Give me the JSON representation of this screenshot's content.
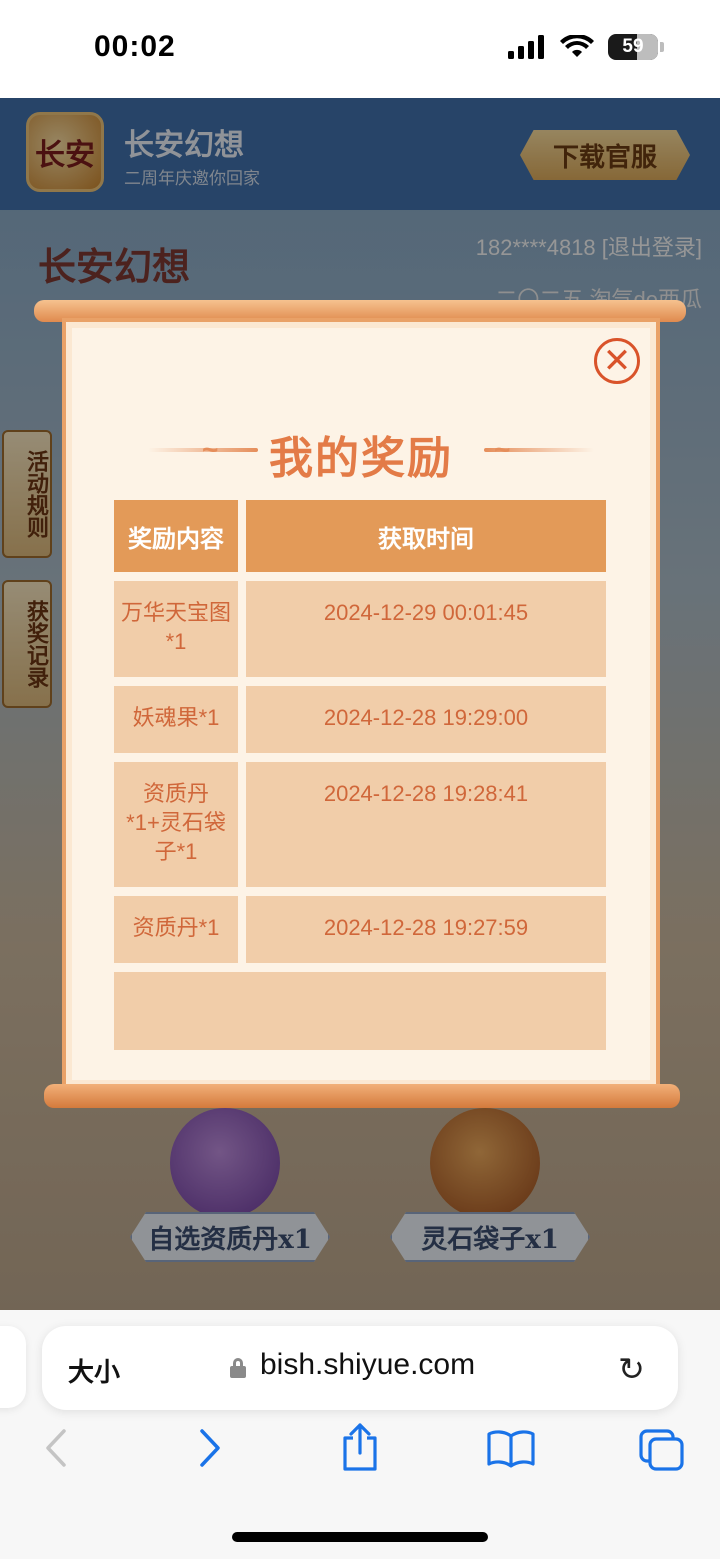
{
  "status_bar": {
    "time": "00:02",
    "battery": "59",
    "battery_level": 0.59
  },
  "banner": {
    "logo_text": "长安",
    "title": "长安幻想",
    "subtitle": "二周年庆邀你回家",
    "download_label": "下载官服"
  },
  "background": {
    "game_logo": "长安幻想",
    "user_line": "182****4818 [退出登录]",
    "user_sub": "二〇二五  淘气de西瓜",
    "side_tabs": [
      "活动规则",
      "获奖记录"
    ],
    "prizes": [
      "自选资质丹x1",
      "灵石袋子x1"
    ]
  },
  "modal": {
    "title": "我的奖励",
    "close_icon": "close-icon",
    "headers": [
      "奖励内容",
      "获取时间"
    ],
    "rows": [
      {
        "item": "万华天宝图*1",
        "time": "2024-12-29 00:01:45"
      },
      {
        "item": "妖魂果*1",
        "time": "2024-12-28 19:29:00"
      },
      {
        "item": "资质丹*1+灵石袋子*1",
        "time": "2024-12-28 19:28:41"
      },
      {
        "item": "资质丹*1",
        "time": "2024-12-28 19:27:59"
      }
    ]
  },
  "safari": {
    "text_size_label": "大小",
    "url": "bish.shiyue.com"
  },
  "colors": {
    "accent": "#e39a58",
    "title": "#e37b47",
    "cell": "#f1cda9",
    "link": "#1a73e8"
  }
}
